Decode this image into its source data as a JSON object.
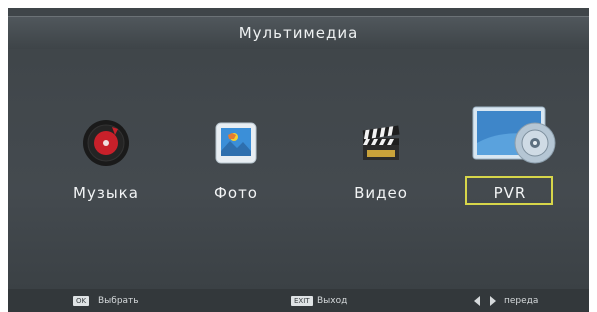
{
  "header": {
    "title": "Мультимедиа"
  },
  "items": [
    {
      "label": "Музыка",
      "icon": "music-disc-icon"
    },
    {
      "label": "Фото",
      "icon": "photo-icon"
    },
    {
      "label": "Видео",
      "icon": "video-clapperboard-icon"
    },
    {
      "label": "PVR",
      "icon": "pvr-disc-icon",
      "selected": true
    }
  ],
  "footer": {
    "ok_key": "OK",
    "ok_label": "Выбрать",
    "exit_key": "EXIT",
    "exit_label": "Выход",
    "nav_label": "переда"
  },
  "colors": {
    "selection": "#d7d64a",
    "background": "#3f4549"
  }
}
